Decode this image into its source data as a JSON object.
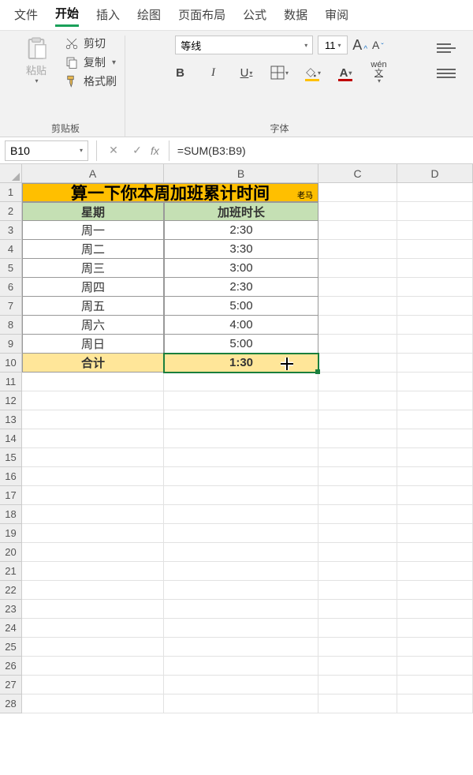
{
  "tabs": [
    "文件",
    "开始",
    "插入",
    "绘图",
    "页面布局",
    "公式",
    "数据",
    "审阅"
  ],
  "active_tab": "开始",
  "clipboard": {
    "group_label": "剪贴板",
    "paste": "粘贴",
    "cut": "剪切",
    "copy": "复制",
    "format_painter": "格式刷"
  },
  "font": {
    "group_label": "字体",
    "name": "等线",
    "size": "11",
    "wen": "wén"
  },
  "namebox": "B10",
  "formula": "=SUM(B3:B9)",
  "fx": "fx",
  "columns": [
    "A",
    "B",
    "C",
    "D"
  ],
  "row_count": 28,
  "sheet": {
    "title": "算一下你本周加班累计时间",
    "title_suffix": "老马",
    "headers": [
      "星期",
      "加班时长"
    ],
    "rows": [
      {
        "day": "周一",
        "dur": "2:30"
      },
      {
        "day": "周二",
        "dur": "3:30"
      },
      {
        "day": "周三",
        "dur": "3:00"
      },
      {
        "day": "周四",
        "dur": "2:30"
      },
      {
        "day": "周五",
        "dur": "5:00"
      },
      {
        "day": "周六",
        "dur": "4:00"
      },
      {
        "day": "周日",
        "dur": "5:00"
      }
    ],
    "total_label": "合计",
    "total_value": "1:30"
  }
}
